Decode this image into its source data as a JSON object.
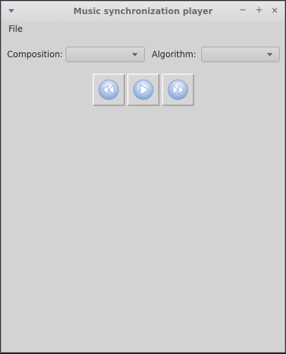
{
  "window": {
    "title": "Music synchronization player",
    "controls": {
      "minimize": "−",
      "maximize": "+",
      "close": "✕"
    }
  },
  "menu": {
    "file": "File"
  },
  "form": {
    "composition_label": "Composition:",
    "composition_value": "",
    "algorithm_label": "Algorithm:",
    "algorithm_value": ""
  },
  "player": {
    "buttons": [
      {
        "name": "rewind",
        "icon": "rewind-icon"
      },
      {
        "name": "play",
        "icon": "play-icon"
      },
      {
        "name": "fast-forward",
        "icon": "fast-forward-icon"
      }
    ]
  },
  "colors": {
    "window_bg": "#d3d3d3",
    "icon_blue": "#5a86d6"
  }
}
